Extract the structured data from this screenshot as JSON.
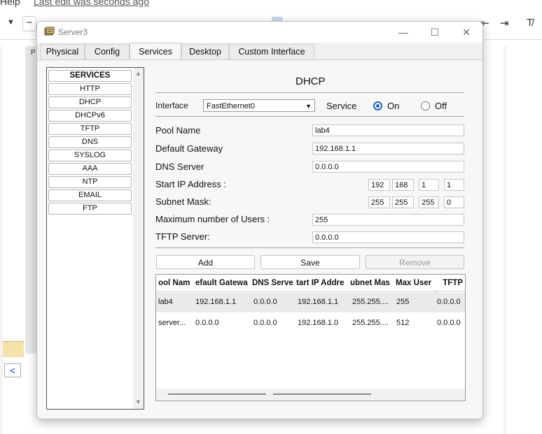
{
  "background_app": {
    "menu_partial": "Help",
    "last_edit": "Last edit was seconds ago",
    "page_letter": "P"
  },
  "window": {
    "title": "Server3",
    "controls": {
      "minimize": "—",
      "maximize": "☐",
      "close": "✕"
    }
  },
  "tabs": [
    {
      "label": "Physical"
    },
    {
      "label": "Config"
    },
    {
      "label": "Services",
      "active": true
    },
    {
      "label": "Desktop"
    },
    {
      "label": "Custom Interface"
    }
  ],
  "services": {
    "header": "SERVICES",
    "items": [
      "HTTP",
      "DHCP",
      "DHCPv6",
      "TFTP",
      "DNS",
      "SYSLOG",
      "AAA",
      "NTP",
      "EMAIL",
      "FTP"
    ]
  },
  "dhcp": {
    "title": "DHCP",
    "interface_label": "Interface",
    "interface_value": "FastEthernet0",
    "service_label": "Service",
    "on_label": "On",
    "off_label": "Off",
    "service_state": "On",
    "pool_name_label": "Pool Name",
    "pool_name_value": "lab4",
    "gateway_label": "Default Gateway",
    "gateway_value": "192.168.1.1",
    "dns_label": "DNS Server",
    "dns_value": "0.0.0.0",
    "start_ip_label": "Start IP Address :",
    "start_ip": [
      "192",
      "168",
      "1",
      "1"
    ],
    "subnet_label": "Subnet Mask:",
    "subnet": [
      "255",
      "255",
      "255",
      "0"
    ],
    "max_users_label": "Maximum number of Users :",
    "max_users_value": "255",
    "tftp_label": "TFTP Server:",
    "tftp_value": "0.0.0.0",
    "buttons": {
      "add": "Add",
      "save": "Save",
      "remove": "Remove"
    }
  },
  "table": {
    "columns": [
      "ool Nam",
      "efault Gatewa",
      "DNS Serve",
      "tart IP Addre",
      "ubnet Mas",
      "Max User",
      "TFTP"
    ],
    "rows": [
      [
        "lab4",
        "192.168.1.1",
        "0.0.0.0",
        "192.168.1.1",
        "255.255....",
        "255",
        "0.0.0.0"
      ],
      [
        "server...",
        "0.0.0.0",
        "0.0.0.0",
        "192.168.1.0",
        "255.255....",
        "512",
        "0.0.0.0"
      ]
    ]
  },
  "colors": {
    "accent": "#1a67c4",
    "window_bg": "#f0f0f0"
  }
}
